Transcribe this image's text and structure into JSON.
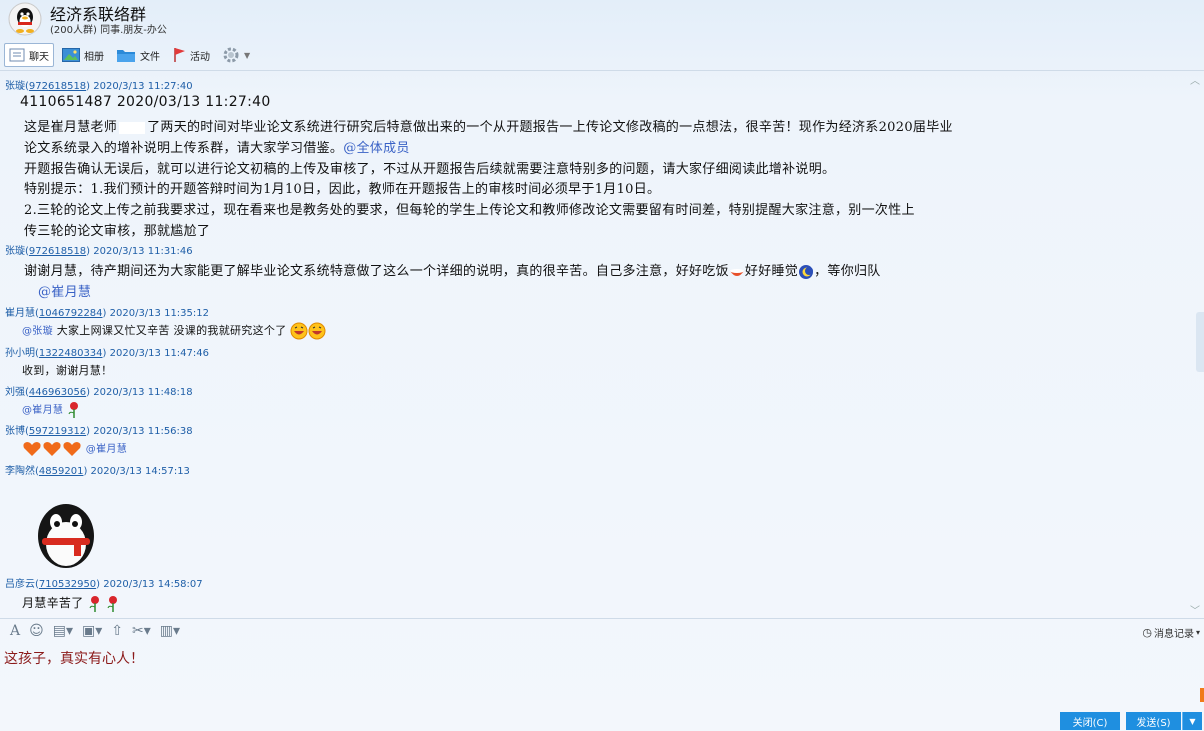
{
  "group": {
    "name": "经济系联络群",
    "info": "(200人群) 同事.朋友-办公"
  },
  "toolbar": {
    "items": [
      {
        "label": "聊天"
      },
      {
        "label": "相册"
      },
      {
        "label": "文件"
      },
      {
        "label": "活动"
      }
    ]
  },
  "messages": [
    {
      "sender": "张璇",
      "qq": "972618518",
      "time": "2020/3/13 11:27:40",
      "lines": [
        "4110651487 2020/03/13 11:27:40",
        "这是崔月慧老师",
        "了两天的时间对毕业论文系统进行研究后特意做出来的一个从开题报告一上传论文修改稿的一点想法，很辛苦！现作为经济系2020届毕业",
        "论文系统录入的增补说明上传系群，请大家学习借鉴。",
        "@全体成员",
        "开题报告确认无误后，就可以进行论文初稿的上传及审核了，不过从开题报告后续就需要注意特别多的问题，请大家仔细阅读此增补说明。",
        "特别提示：1.我们预计的开题答辩时间为1月10日，因此，教师在开题报告上的审核时间必须早于1月10日。",
        "2.三轮的论文上传之前我要求过，现在看来也是教务处的要求，但每轮的学生上传论文和教师修改论文需要留有时间差，特别提醒大家注意，别一次性上",
        "传三轮的论文审核，那就尴尬了"
      ]
    },
    {
      "sender": "张璇",
      "qq": "972618518",
      "time": "2020/3/13 11:31:46",
      "lines": [
        "谢谢月慧，待产期间还为大家能更了解毕业论文系统特意做了这么一个详细的说明，真的很辛苦。自己多注意，好好吃饭",
        "好好睡觉",
        "，等你归队",
        "@崔月慧"
      ]
    },
    {
      "sender": "崔月慧",
      "qq": "1046792284",
      "time": "2020/3/13 11:35:12",
      "mention": "@张璇",
      "text": "大家上网课又忙又辛苦 没课的我就研究这个了"
    },
    {
      "sender": "孙小明",
      "qq": "1322480334",
      "time": "2020/3/13 11:47:46",
      "text": "收到，谢谢月慧！"
    },
    {
      "sender": "刘强",
      "qq": "446963056",
      "time": "2020/3/13 11:48:18",
      "mention": "@崔月慧"
    },
    {
      "sender": "张博",
      "qq": "597219312",
      "time": "2020/3/13 11:56:38",
      "mention": "@崔月慧"
    },
    {
      "sender": "李陶然",
      "qq": "4859201",
      "time": "2020/3/13 14:57:13"
    },
    {
      "sender": "吕彦云",
      "qq": "710532950",
      "time": "2020/3/13 14:58:07",
      "text": "月慧辛苦了"
    }
  ],
  "input": {
    "text": "这孩子，真实有心人！"
  },
  "history_label": "消息记录",
  "buttons": {
    "close": "关闭(C)",
    "send": "发送(S)"
  },
  "colors": {
    "accent": "#1f8fe0",
    "link": "#1f5fa8",
    "input_text": "#8b1a1a"
  }
}
